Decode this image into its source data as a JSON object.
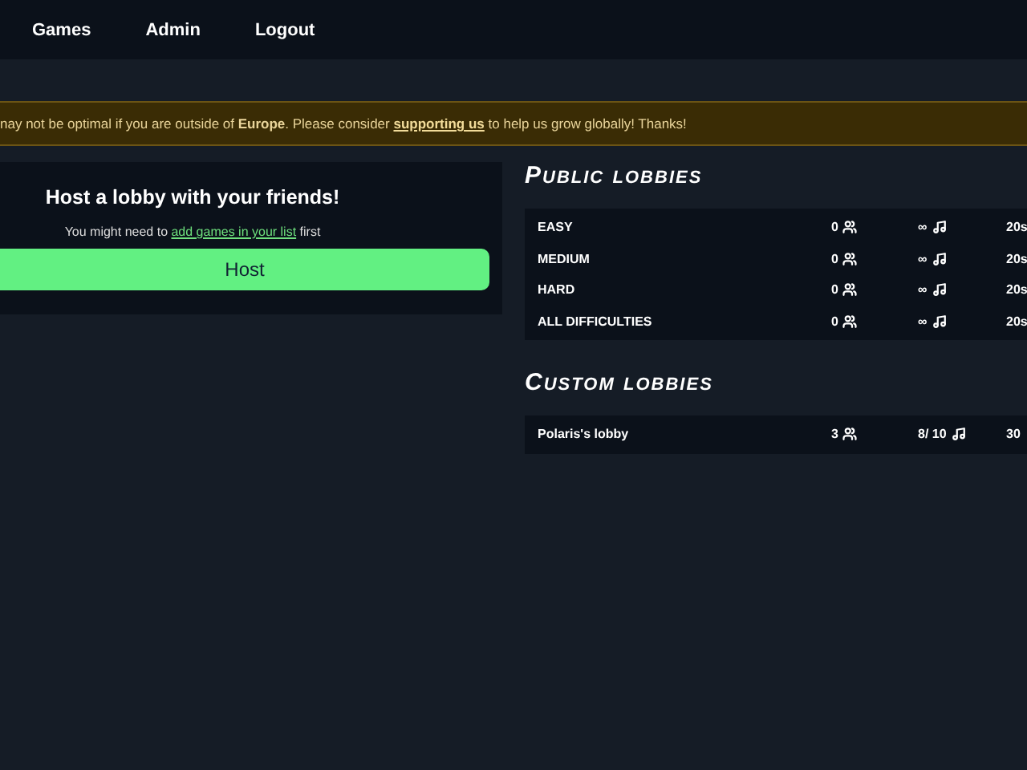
{
  "nav": {
    "items": [
      "Games",
      "Admin",
      "Logout"
    ]
  },
  "banner": {
    "before": "nay not be optimal if you are outside of **Europe**. Please consider ",
    "link": "supporting us",
    "after": " to help us grow globally! Thanks!"
  },
  "host_card": {
    "title": "Host a lobby with your friends!",
    "hint_before": "You might need to ",
    "hint_link": "add games in your list",
    "hint_after": " first",
    "button": "Host"
  },
  "public_lobbies": {
    "title": "Public lobbies",
    "rows": [
      {
        "name": "EASY",
        "players": "0",
        "songs": "∞",
        "time": "20s"
      },
      {
        "name": "MEDIUM",
        "players": "0",
        "songs": "∞",
        "time": "20s"
      },
      {
        "name": "HARD",
        "players": "0",
        "songs": "∞",
        "time": "20s"
      },
      {
        "name": "ALL DIFFICULTIES",
        "players": "0",
        "songs": "∞",
        "time": "20s"
      }
    ]
  },
  "custom_lobbies": {
    "title": "Custom lobbies",
    "rows": [
      {
        "name": "Polaris's lobby",
        "players": "3",
        "songs": "8/ 10",
        "time": "30"
      }
    ]
  }
}
